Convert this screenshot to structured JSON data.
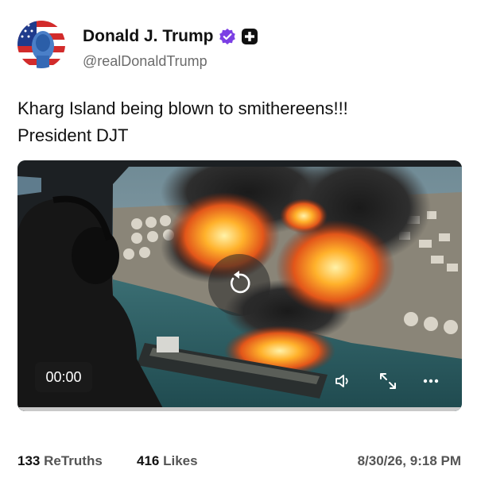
{
  "author": {
    "display_name": "Donald J. Trump",
    "handle": "@realDonaldTrump",
    "verified_icon": "verified-badge-icon",
    "plus_icon": "plus-badge-icon",
    "accent_color": "#7b3fe4"
  },
  "post": {
    "line1": "Kharg Island being blown to smithereens!!!",
    "line2": "President DJT"
  },
  "video": {
    "time": "00:00",
    "replay_icon": "replay-icon",
    "volume_icon": "volume-icon",
    "fullscreen_icon": "fullscreen-icon",
    "more_icon": "more-icon",
    "progress": 0
  },
  "stats": {
    "retruths_count": "133",
    "retruths_label": "ReTruths",
    "likes_count": "416",
    "likes_label": "Likes",
    "date": "8/30/26, 9:18 PM"
  }
}
